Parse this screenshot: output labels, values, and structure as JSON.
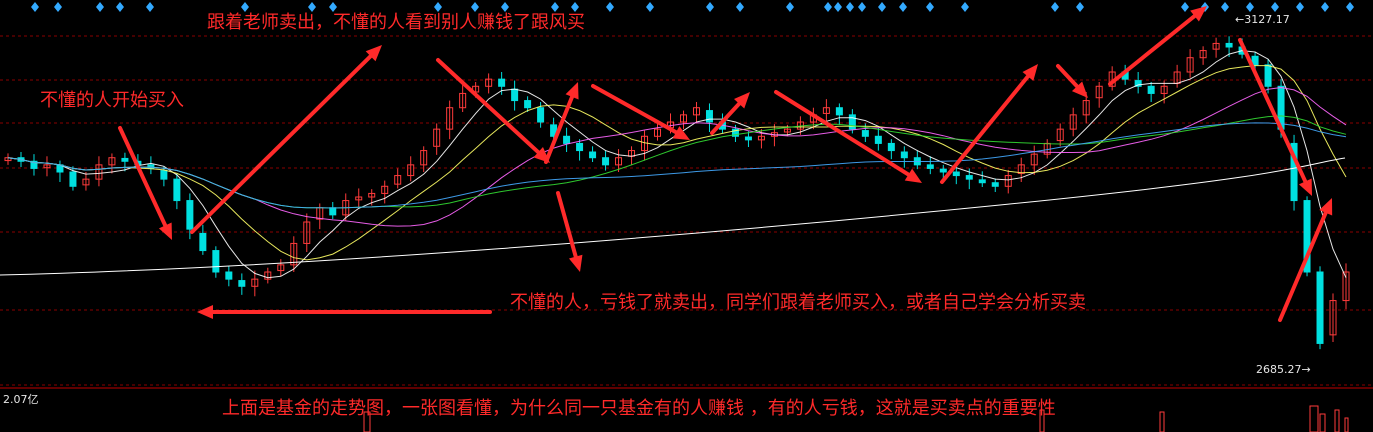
{
  "annotations": {
    "top": "跟着老师卖出，不懂的人看到别人赚钱了跟风买",
    "left": "不懂的人开始买入",
    "middle": "不懂的人，亏钱了就卖出，同学们跟着老师买入，或者自己学会分析买卖",
    "bottom": "上面是基金的走势图，一张图看懂，为什么同一只基金有的人赚钱 ，有的人亏钱，这就是买卖点的重要性"
  },
  "price_labels": {
    "high": "3127.17",
    "low": "2685.27"
  },
  "volume_label": "2.07亿",
  "colors": {
    "background": "#000000",
    "up": "#ff3b3b",
    "down": "#00e0e0",
    "ma5": "#ffffff",
    "ma10": "#ffff66",
    "ma20": "#ff66ff",
    "ma30": "#33dd33",
    "ma60": "#44aaff",
    "ma120": "#ffffff",
    "annotation": "#ff2a2a",
    "grid": "#8a0000"
  },
  "chart_data": {
    "type": "candlestick",
    "title": "",
    "ylim": [
      2660,
      3150
    ],
    "high_marker": 3127.17,
    "low_marker": 2685.27,
    "close": [
      2960,
      2955,
      2945,
      2950,
      2940,
      2920,
      2930,
      2950,
      2960,
      2955,
      2950,
      2945,
      2930,
      2900,
      2860,
      2830,
      2800,
      2790,
      2780,
      2790,
      2800,
      2810,
      2840,
      2870,
      2890,
      2880,
      2900,
      2905,
      2910,
      2920,
      2935,
      2950,
      2970,
      3000,
      3030,
      3050,
      3060,
      3070,
      3060,
      3040,
      3030,
      3010,
      2990,
      2980,
      2970,
      2960,
      2950,
      2960,
      2970,
      2990,
      3000,
      3010,
      3020,
      3030,
      3010,
      3000,
      2990,
      2985,
      2990,
      2995,
      3000,
      3010,
      3020,
      3030,
      3020,
      3000,
      2990,
      2980,
      2970,
      2960,
      2950,
      2945,
      2940,
      2935,
      2930,
      2925,
      2920,
      2935,
      2950,
      2965,
      2980,
      3000,
      3020,
      3040,
      3060,
      3080,
      3070,
      3060,
      3050,
      3060,
      3080,
      3100,
      3110,
      3120,
      3115,
      3105,
      3090,
      3060,
      3000,
      2900,
      2800,
      2700,
      2760,
      2800
    ],
    "ma_lines": [
      "MA5",
      "MA10",
      "MA20",
      "MA30",
      "MA60",
      "MA120"
    ]
  }
}
